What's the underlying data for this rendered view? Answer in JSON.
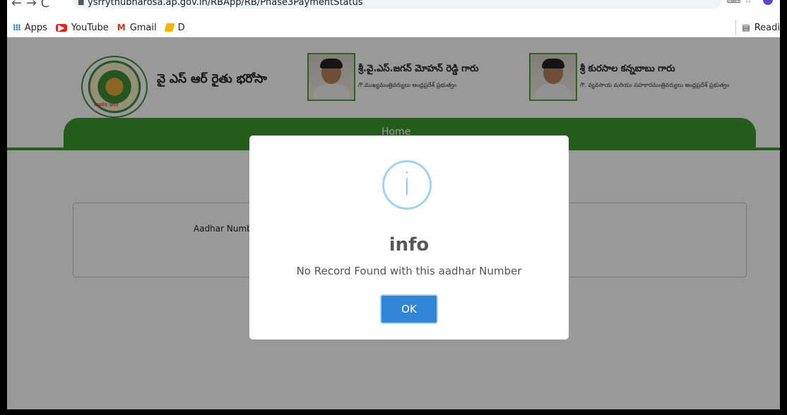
{
  "browser": {
    "url": "ysrrythubharosa.ap.gov.in/RBApp/RB/Phase3PaymentStatus",
    "bookmarks": [
      {
        "label": "Apps",
        "icon": "apps-icon"
      },
      {
        "label": "YouTube",
        "icon": "youtube-icon"
      },
      {
        "label": "Gmail",
        "icon": "gmail-icon"
      },
      {
        "label": "D",
        "icon": "bookmark-icon"
      }
    ],
    "reading_list_label": "Readi"
  },
  "header": {
    "site_title": "వై ఎస్ ఆర్ రైతు భరోసా",
    "emblem_text": "सत्यमेव जयते",
    "cm_name": "శ్రీ.వై.ఎస్.జగన్ మోహన్ రెడ్డి గారు",
    "cm_designation": "గౌ.ముఖ్యమంత్రివర్యులు ఆంధ్రప్రదేశ్ ప్రభుత్వం",
    "minister_name": "శ్రీ కురసాల కన్నబాబు గారు",
    "minister_designation": "గౌ. వ్యవసాయ మరియు సహకారమంత్రివర్యులు ఆంధ్రప్రదేశ్ ప్రభుత్వం"
  },
  "nav": {
    "home_label": "Home"
  },
  "form": {
    "aadhar_label": "Aadhar Numb"
  },
  "modal": {
    "icon": "info-icon",
    "title": "info",
    "message": "No Record Found with this aadhar Number",
    "ok_label": "OK"
  }
}
